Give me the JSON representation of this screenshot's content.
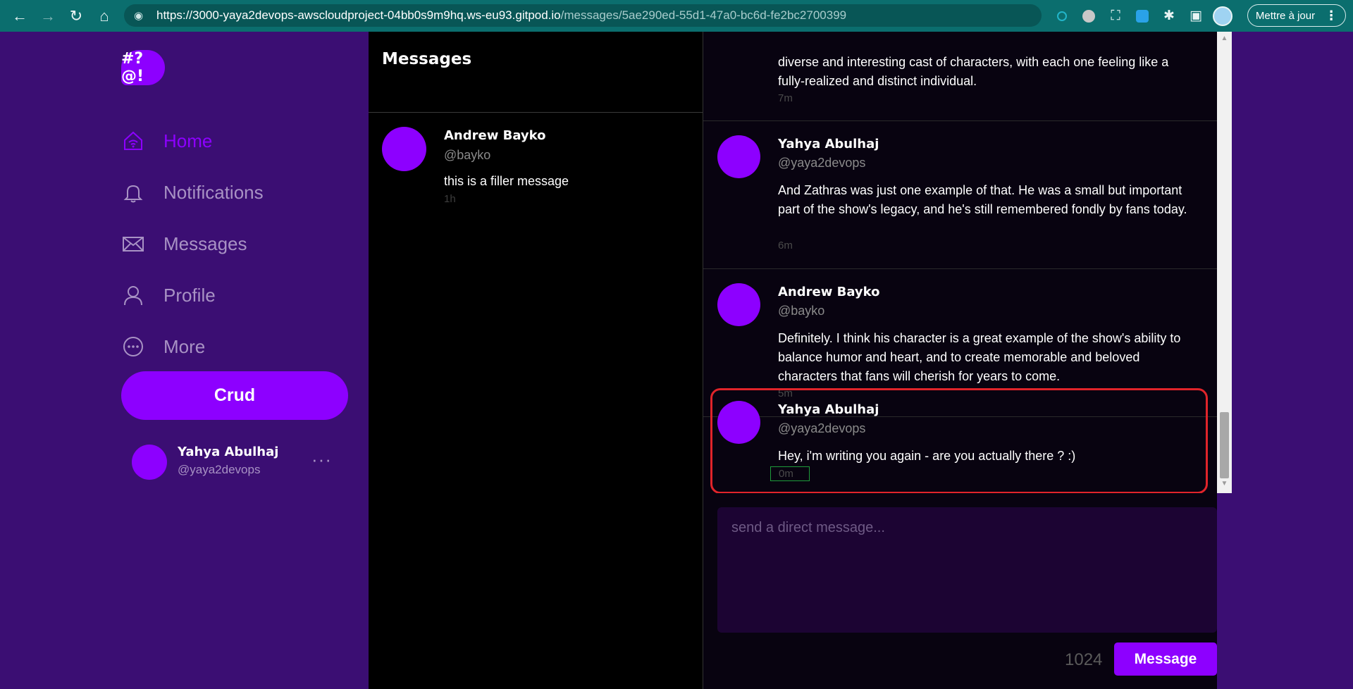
{
  "browser": {
    "url_host": "https://3000-yaya2devops-awscloudproject-04bb0s9m9hq.ws-eu93.gitpod.io",
    "url_path": "/messages/5ae290ed-55d1-47a0-bc6d-fe2bc2700399",
    "update_label": "Mettre à jour"
  },
  "sidebar": {
    "logo": "#?@!",
    "items": [
      {
        "label": "Home"
      },
      {
        "label": "Notifications"
      },
      {
        "label": "Messages"
      },
      {
        "label": "Profile"
      },
      {
        "label": "More"
      }
    ],
    "crud_label": "Crud",
    "me": {
      "name": "Yahya Abulhaj",
      "handle": "@yaya2devops",
      "more": "···"
    }
  },
  "groups": {
    "title": "Messages",
    "items": [
      {
        "name": "Andrew Bayko",
        "handle": "@bayko",
        "text": "this is a filler message",
        "time": "1h"
      }
    ]
  },
  "messages": [
    {
      "text_partial": "diverse and interesting cast of characters, with each one feeling like a fully-realized and distinct individual.",
      "time": "7m"
    },
    {
      "name": "Yahya Abulhaj",
      "handle": "@yaya2devops",
      "text": "And Zathras was just one example of that. He was a small but important part of the show's legacy, and he's still remembered fondly by fans today.",
      "time": "6m"
    },
    {
      "name": "Andrew Bayko",
      "handle": "@bayko",
      "text": "Definitely. I think his character is a great example of the show's ability to balance humor and heart, and to create memorable and beloved characters that fans will cherish for years to come.",
      "time": "5m"
    },
    {
      "name": "Yahya Abulhaj",
      "handle": "@yaya2devops",
      "text": "Hey, i'm writing you again - are you actually there ? :)",
      "time": "0m"
    }
  ],
  "compose": {
    "placeholder": "send a direct message...",
    "counter": "1024",
    "send_label": "Message"
  },
  "colors": {
    "accent": "#8d00ff",
    "sidebar_bg": "#3b0e73",
    "highlight_border": "#e0242a",
    "browser_bar": "#0b6e6e"
  }
}
